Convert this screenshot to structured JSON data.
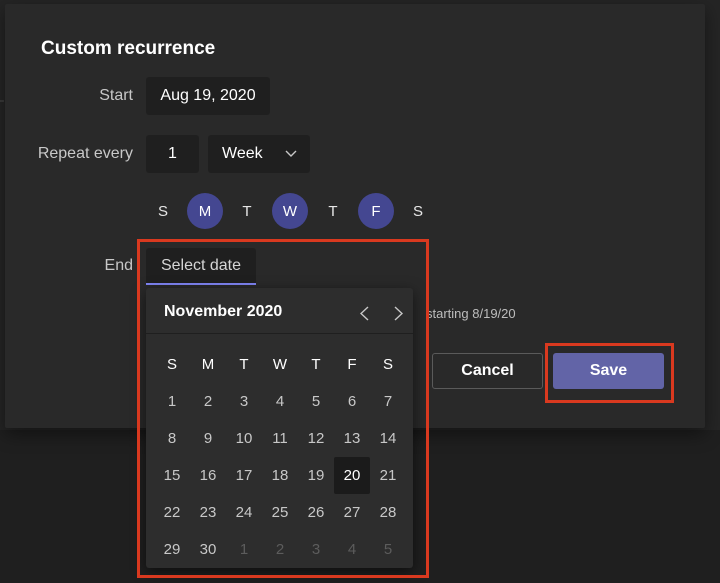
{
  "dialog": {
    "title": "Custom recurrence",
    "start": {
      "label": "Start",
      "value": "Aug 19, 2020"
    },
    "repeat": {
      "label": "Repeat every",
      "interval": "1",
      "unit": "Week"
    },
    "weekdays": [
      {
        "letter": "S",
        "selected": false
      },
      {
        "letter": "M",
        "selected": true
      },
      {
        "letter": "T",
        "selected": false
      },
      {
        "letter": "W",
        "selected": true
      },
      {
        "letter": "T",
        "selected": false
      },
      {
        "letter": "F",
        "selected": true
      },
      {
        "letter": "S",
        "selected": false
      }
    ],
    "end": {
      "label": "End",
      "value": "Select date"
    },
    "summary": "starting 8/19/20",
    "cancel_label": "Cancel",
    "save_label": "Save"
  },
  "calendar": {
    "month_label": "November 2020",
    "headers": [
      "S",
      "M",
      "T",
      "W",
      "T",
      "F",
      "S"
    ],
    "weeks": [
      [
        "1",
        "2",
        "3",
        "4",
        "5",
        "6",
        "7"
      ],
      [
        "8",
        "9",
        "10",
        "11",
        "12",
        "13",
        "14"
      ],
      [
        "15",
        "16",
        "17",
        "18",
        "19",
        "20",
        "21"
      ],
      [
        "22",
        "23",
        "24",
        "25",
        "26",
        "27",
        "28"
      ],
      [
        "29",
        "30",
        "1",
        "2",
        "3",
        "4",
        "5"
      ]
    ],
    "today": "20",
    "icons": {
      "prev": "chevron-left-icon",
      "next": "chevron-right-icon",
      "dropdown": "chevron-down-icon"
    }
  },
  "colors": {
    "accent": "#6264a7",
    "selected_day": "#444791",
    "highlight": "#d9391f"
  }
}
